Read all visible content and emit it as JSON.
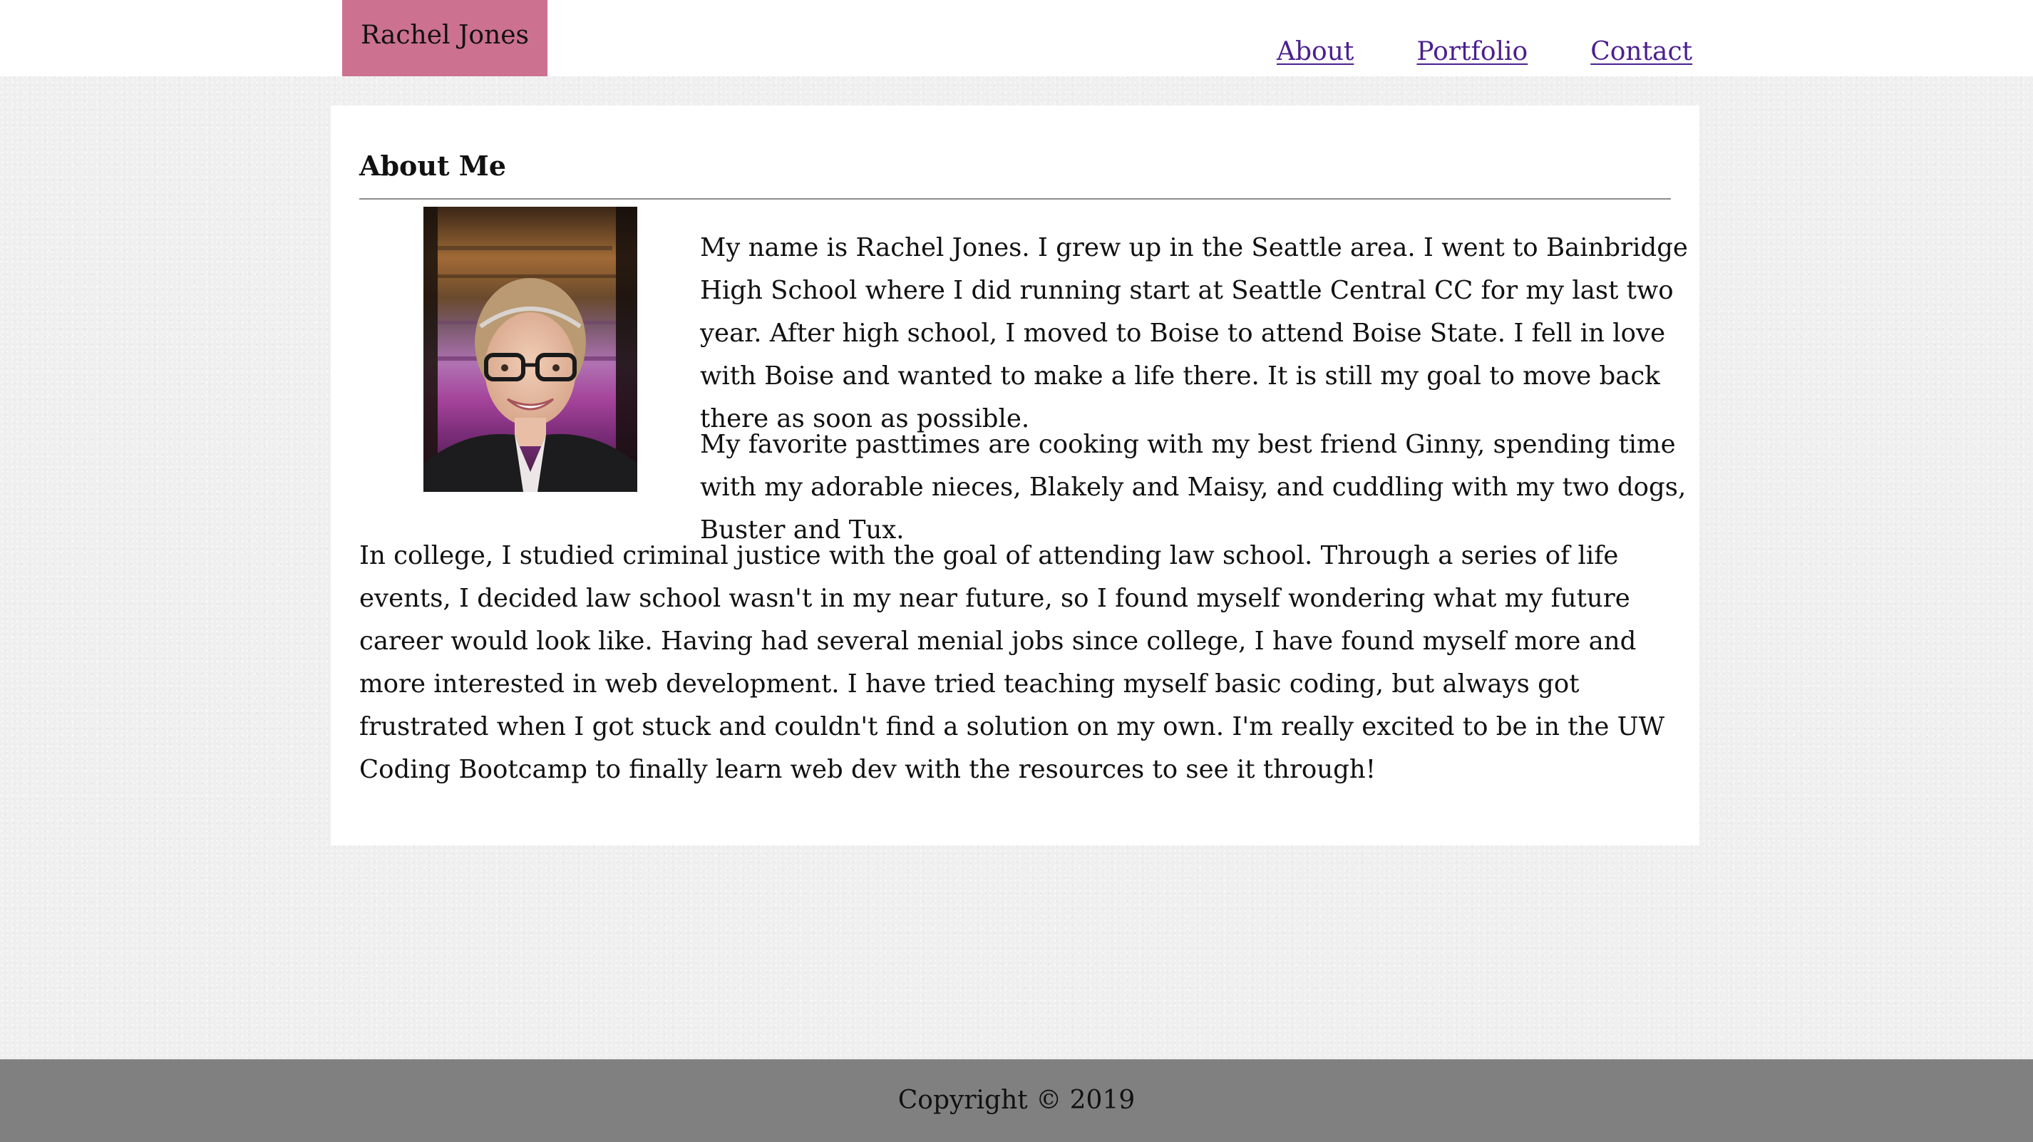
{
  "header": {
    "brand": "Rachel Jones",
    "nav": [
      {
        "label": "About"
      },
      {
        "label": "Portfolio"
      },
      {
        "label": "Contact"
      }
    ]
  },
  "main": {
    "title": "About Me",
    "photo_icon": "profile-photo",
    "paragraphs": [
      "My name is Rachel Jones. I grew up in the Seattle area. I went to Bainbridge High School where I did running start at Seattle Central CC for my last two year. After high school, I moved to Boise to attend Boise State. I fell in love with Boise and wanted to make a life there. It is still my goal to move back there as soon as possible.",
      "My favorite pasttimes are cooking with my best friend Ginny, spending time with my adorable nieces, Blakely and Maisy, and cuddling with my two dogs, Buster and Tux.",
      "In college, I studied criminal justice with the goal of attending law school. Through a series of life events, I decided law school wasn't in my near future, so I found myself wondering what my future career would look like. Having had several menial jobs since college, I have found myself more and more interested in web development. I have tried teaching myself basic coding, but always got frustrated when I got stuck and couldn't find a solution on my own. I'm really excited to be in the UW Coding Bootcamp to finally learn web dev with the resources to see it through!"
    ]
  },
  "footer": {
    "copyright": "Copyright © 2019"
  },
  "colors": {
    "brand_bg": "#cc7190",
    "link": "#4b1f8f",
    "footer_bg": "#808080",
    "page_bg": "#efefef"
  }
}
